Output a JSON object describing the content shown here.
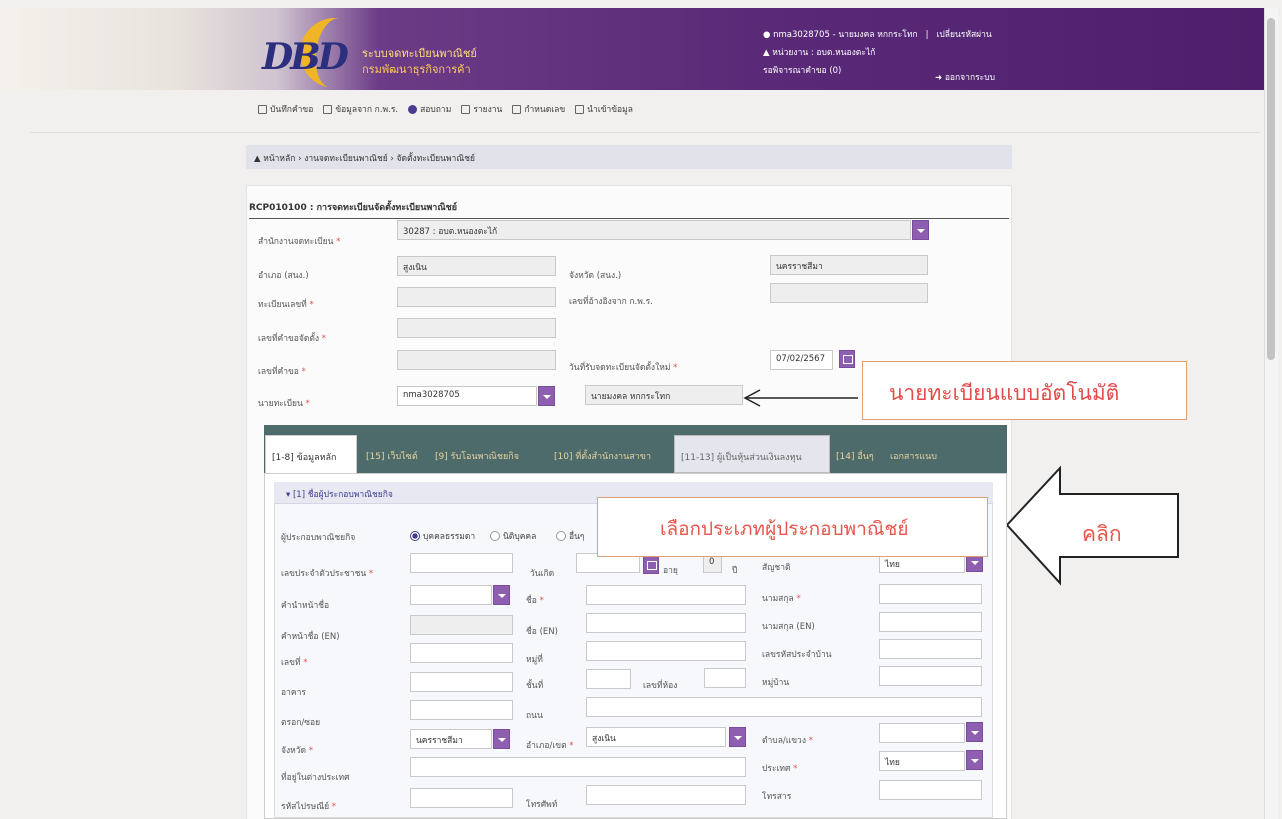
{
  "header": {
    "logo": "DBD",
    "org_line1": "ระบบจดทะเบียนพาณิชย์",
    "org_line2": "กรมพัฒนาธุรกิจการค้า",
    "user": "nma3028705 - นายมงคล หกกระโทก",
    "change_password": "เปลี่ยนรหัสผ่าน",
    "unit": "หน่วยงาน : อบต.หนองตะไก้",
    "pending": "รอพิจารณาคำขอ (0)",
    "logout": "ออกจากระบบ"
  },
  "toolbar": {
    "items": [
      "บันทึกคำขอ",
      "ข้อมูลจาก ก.พ.ร.",
      "สอบถาม",
      "รายงาน",
      "กำหนดเลข",
      "นำเข้าข้อมูล"
    ]
  },
  "breadcrumb": "หน้าหลัก › งานจดทะเบียนพาณิชย์ › จัดตั้งทะเบียนพาณิชย์",
  "form": {
    "code_title": "RCP010100 : การจดทะเบียนจัดตั้งทะเบียนพาณิชย์",
    "office_label": "สำนักงานจดทะเบียน",
    "office_value": "30287 : อบต.หนองตะไก้",
    "amphoe_label": "อำเภอ (สนง.)",
    "amphoe_value": "สูงเนิน",
    "province_label": "จังหวัด (สนง.)",
    "province_value": "นครราชสีมา",
    "reg_no_label": "ทะเบียนเลขที่",
    "ref_label": "เลขที่อ้างอิงจาก ก.พ.ร.",
    "setup_req_label": "เลขที่คำขอจัดตั้ง",
    "req_no_label": "เลขที่คำขอ",
    "receive_date_label": "วันที่รับจดทะเบียนจัดตั้งใหม่",
    "receive_date_value": "07/02/2567",
    "registrar_label": "นายทะเบียน",
    "registrar_code": "nma3028705",
    "registrar_name": "นายมงคล หกกระโทก"
  },
  "tabs": [
    "[1-8] ข้อมูลหลัก",
    "[15] เว็บไซต์",
    "[9] รับโอนพาณิชยกิจ",
    "[10] ที่ตั้งสำนักงานสาขา",
    "[11-13] ผู้เป็นหุ้นส่วนเงินลงทุน",
    "[14] อื่นๆ",
    "เอกสารแนบ"
  ],
  "section": {
    "title": "[1] ชื่อผู้ประกอบพาณิชยกิจ",
    "type_label": "ผู้ประกอบพาณิชยกิจ",
    "radios": [
      "บุคคลธรรมดา",
      "นิติบุคคล",
      "อื่นๆ"
    ],
    "id_label": "เลขประจำตัวประชาชน",
    "birth_label": "วันเกิด",
    "age_label": "อายุ",
    "age_value": "0",
    "age_unit": "ปี",
    "nation_label": "สัญชาติ",
    "nation_value": "ไทย",
    "prefix_label": "คำนำหน้าชื่อ",
    "name_label": "ชื่อ",
    "surname_label": "นามสกุล",
    "prefix_en_label": "คำหน้าชื่อ (EN)",
    "name_en_label": "ชื่อ (EN)",
    "surname_en_label": "นามสกุล (EN)",
    "addr_no_label": "เลขที่",
    "moo_label": "หมู่ที่",
    "house_code_label": "เลขรหัสประจำบ้าน",
    "building_label": "อาคาร",
    "floor_label": "ชั้นที่",
    "room_label": "เลขที่ห้อง",
    "village_label": "หมู่บ้าน",
    "soi_label": "ตรอก/ซอย",
    "road_label": "ถนน",
    "prov_label": "จังหวัด",
    "prov_value": "นครราชสีมา",
    "district_label": "อำเภอ/เขต",
    "district_value": "สูงเนิน",
    "subdistrict_label": "ตำบล/แขวง",
    "abroad_label": "ที่อยู่ในต่างประเทศ",
    "country_label": "ประเทศ",
    "country_value": "ไทย",
    "zip_label": "รหัสไปรษณีย์",
    "phone_label": "โทรศัพท์",
    "fax_label": "โทรสาร"
  },
  "annotations": {
    "auto_registrar": "นายทะเบียนแบบอัตโนมัติ",
    "choose_type": "เลือกประเภทผู้ประกอบพาณิชย์",
    "click": "คลิก"
  },
  "colors": {
    "header_purple": "#5a2a78",
    "accent_purple": "#8e5fb0",
    "tab_bar": "#4e6b6c",
    "annotation_red": "#e34b4b"
  }
}
